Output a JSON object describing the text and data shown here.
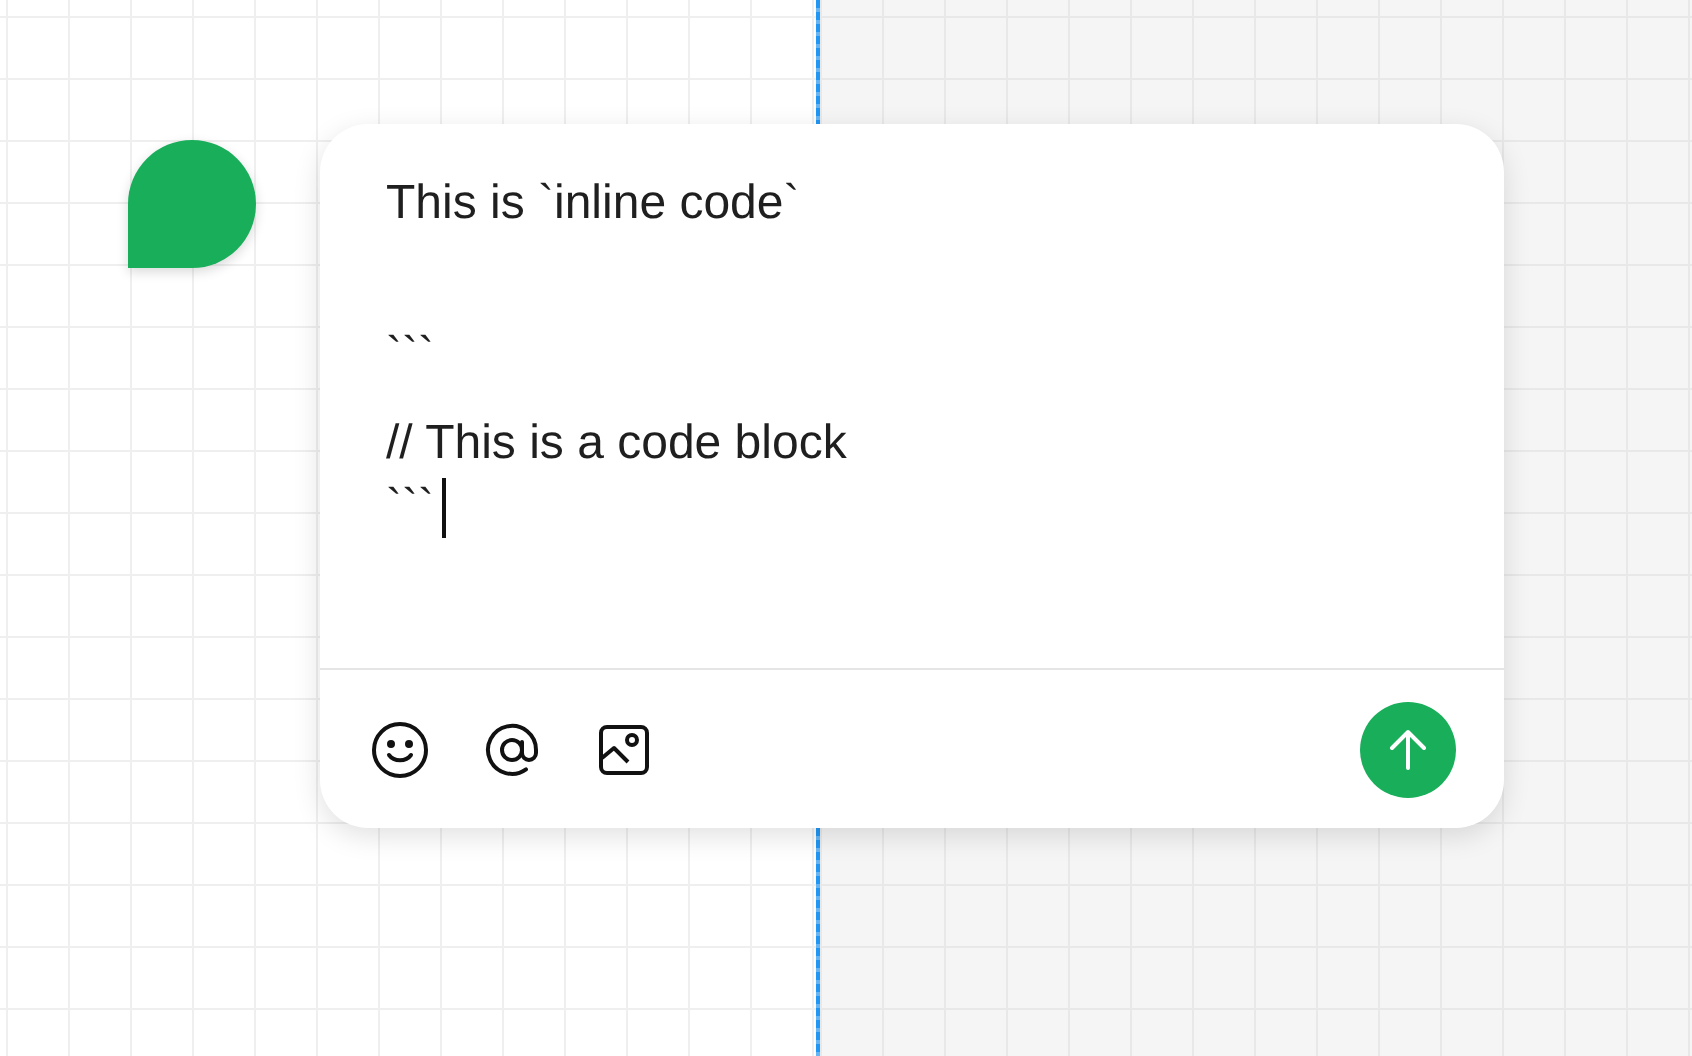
{
  "editor": {
    "lines": [
      "This is `inline code`",
      "```",
      "// This is a code block",
      "```"
    ]
  }
}
